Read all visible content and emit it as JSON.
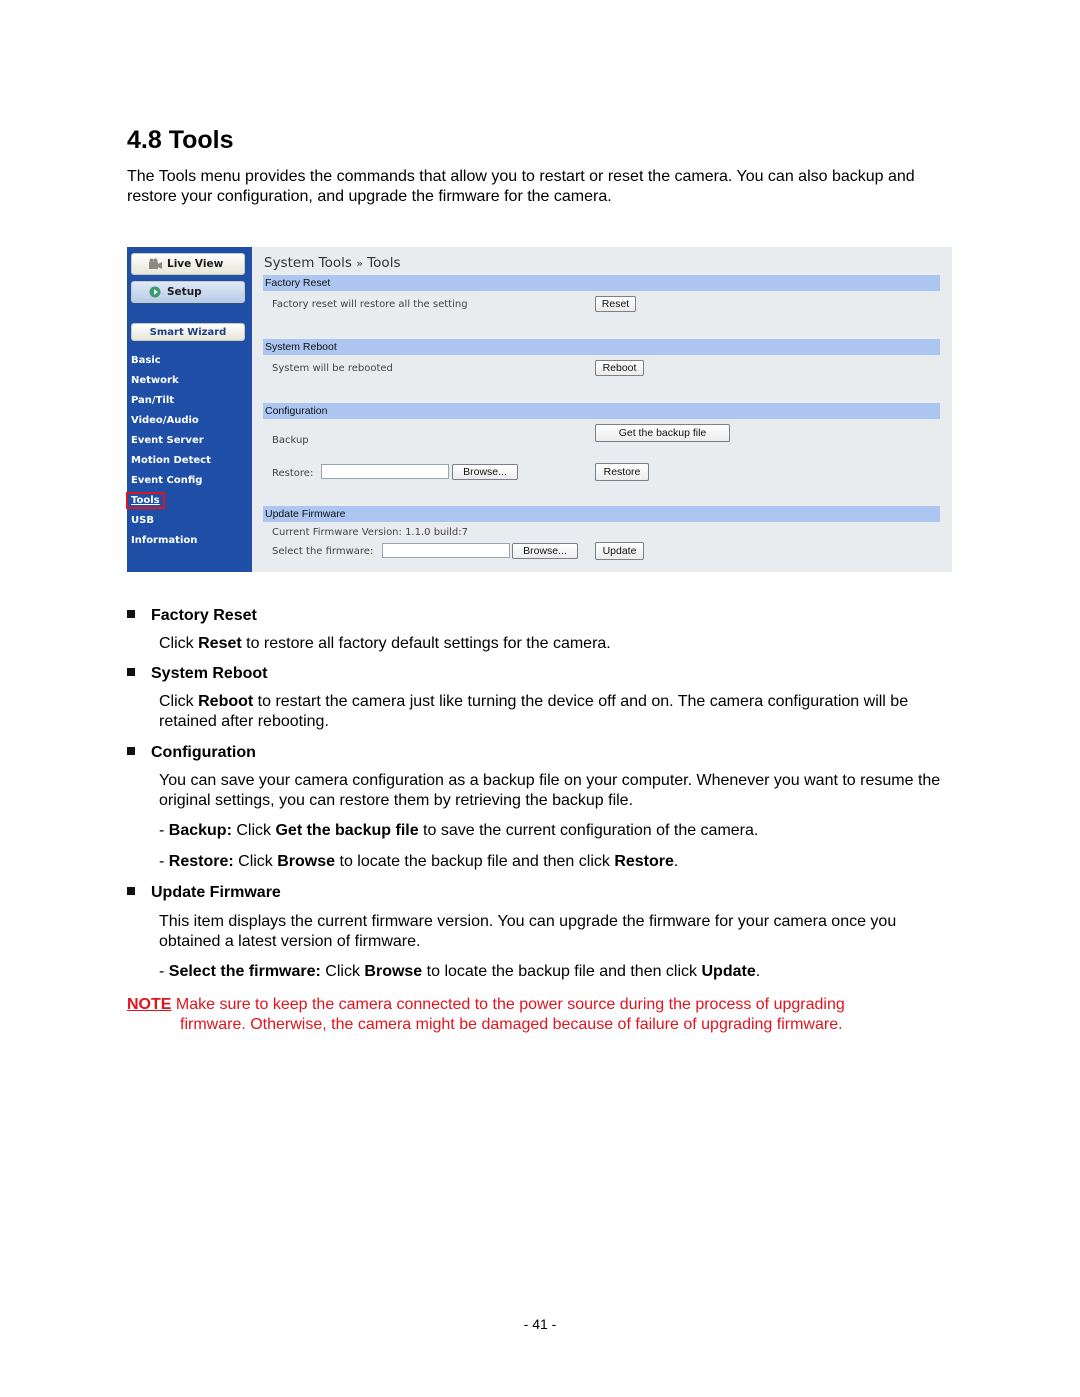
{
  "heading": "4.8  Tools",
  "intro": "The Tools menu provides the commands that allow you to restart or reset the camera. You can also backup and restore your configuration, and upgrade the firmware for the camera.",
  "screenshot": {
    "sidebar": {
      "live_view": "Live View",
      "setup": "Setup",
      "smart_wizard": "Smart Wizard",
      "items": [
        "Basic",
        "Network",
        "Pan/Tilt",
        "Video/Audio",
        "Event Server",
        "Motion Detect",
        "Event Config",
        "Tools",
        "USB",
        "Information"
      ],
      "active": "Tools"
    },
    "title_prefix": "System Tools",
    "title_sep": "»",
    "title_page": "Tools",
    "factory_reset": {
      "header": "Factory Reset",
      "text": "Factory reset will restore all the setting",
      "button": "Reset"
    },
    "system_reboot": {
      "header": "System Reboot",
      "text": "System will be rebooted",
      "button": "Reboot"
    },
    "configuration": {
      "header": "Configuration",
      "backup_label": "Backup",
      "backup_button": "Get the backup file",
      "restore_label": "Restore:",
      "restore_value": "",
      "browse_button": "Browse...",
      "restore_button": "Restore"
    },
    "update_firmware": {
      "header": "Update Firmware",
      "version": "Current Firmware Version: 1.1.0 build:7",
      "select_label": "Select the firmware:",
      "select_value": "",
      "browse_button": "Browse...",
      "update_button": "Update"
    }
  },
  "sections": {
    "factory_reset": {
      "title": "Factory Reset",
      "p1a": "Click ",
      "p1b": "Reset",
      "p1c": " to restore all factory default settings for the camera."
    },
    "system_reboot": {
      "title": "System Reboot",
      "p1a": "Click ",
      "p1b": "Reboot",
      "p1c": " to restart the camera just like turning the device off and on. The camera configuration will be retained after rebooting."
    },
    "configuration": {
      "title": "Configuration",
      "p1": "You can save your camera configuration as a backup file on your computer. Whenever you want to resume the original settings, you can restore them by retrieving the backup file.",
      "backup": {
        "a": "Backup:",
        "b": " Click ",
        "c": "Get the backup file",
        "d": " to save the current configuration of the camera."
      },
      "restore": {
        "a": "Restore:",
        "b": " Click ",
        "c": "Browse",
        "d": " to locate the backup file and then click ",
        "e": "Restore",
        "f": "."
      }
    },
    "update_firmware": {
      "title": "Update Firmware",
      "p1": "This item displays the current firmware version. You can upgrade the firmware for your camera once you obtained a latest version of firmware.",
      "select": {
        "a": "Select the firmware:",
        "b": " Click ",
        "c": "Browse",
        "d": " to locate the backup file and then click ",
        "e": "Update",
        "f": "."
      }
    }
  },
  "note": {
    "tag": "NOTE",
    "line1": " Make sure to keep the camera connected to the power source during the process of upgrading",
    "line2": "firmware. Otherwise, the camera might be damaged because of failure of upgrading firmware."
  },
  "page_number": "- 41 -",
  "colors": {
    "sidebar": "#1f4fa6",
    "section_bar": "#adc6f1",
    "note": "#e0141e",
    "highlight": "#e0141e"
  }
}
